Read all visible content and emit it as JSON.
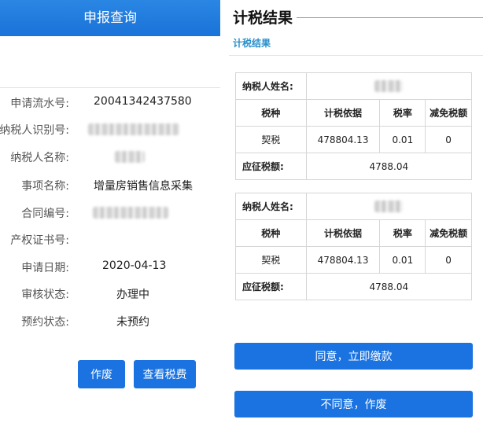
{
  "left": {
    "header_title": "申报查询",
    "fields": [
      {
        "label": "申请流水号:",
        "value": "20041342437580"
      },
      {
        "label": "纳税人识别号:",
        "value": ""
      },
      {
        "label": "纳税人名称:",
        "value": ""
      },
      {
        "label": "事项名称:",
        "value": "增量房销售信息采集"
      },
      {
        "label": "合同编号:",
        "value": ""
      },
      {
        "label": "产权证书号:",
        "value": ""
      },
      {
        "label": "申请日期:",
        "value": "2020-04-13"
      },
      {
        "label": "审核状态:",
        "value": "办理中"
      },
      {
        "label": "预约状态:",
        "value": "未预约"
      }
    ],
    "buttons": {
      "void": "作废",
      "view_tax": "查看税费"
    }
  },
  "right": {
    "title": "计税结果",
    "subtitle": "计税结果",
    "tables": [
      {
        "taxpayer_label": "纳税人姓名:",
        "headers": [
          "税种",
          "计税依据",
          "税率",
          "减免税额"
        ],
        "row": [
          "契税",
          "478804.13",
          "0.01",
          "0"
        ],
        "payable_label": "应征税额:",
        "payable_value": "4788.04"
      },
      {
        "taxpayer_label": "纳税人姓名:",
        "headers": [
          "税种",
          "计税依据",
          "税率",
          "减免税额"
        ],
        "row": [
          "契税",
          "478804.13",
          "0.01",
          "0"
        ],
        "payable_label": "应征税额:",
        "payable_value": "4788.04"
      }
    ],
    "buttons": {
      "agree": "同意，立即缴款",
      "disagree": "不同意，作废"
    }
  },
  "colors": {
    "primary_blue": "#1a73e0",
    "header_blue": "#1a73d9",
    "subtitle_blue": "#2a8fcc"
  }
}
